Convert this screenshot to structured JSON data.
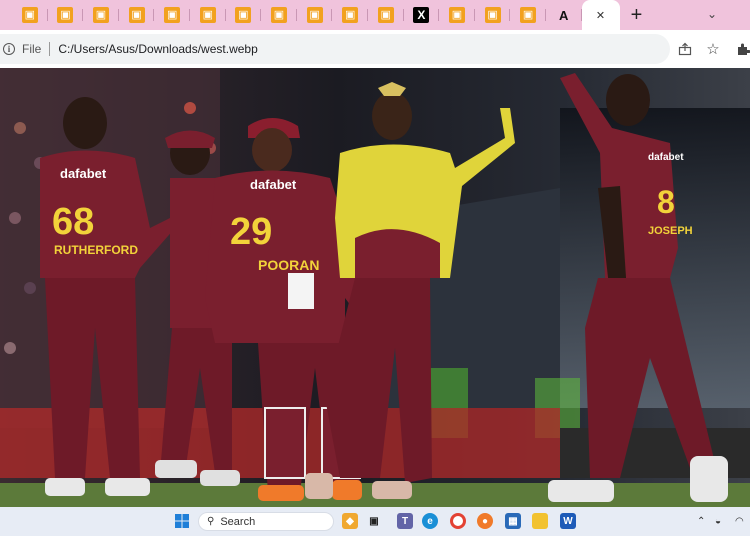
{
  "browser": {
    "tabs": [
      {
        "icon": "orange-favicon",
        "glyph": "▣"
      },
      {
        "icon": "orange-favicon",
        "glyph": "▣"
      },
      {
        "icon": "orange-favicon",
        "glyph": "▣"
      },
      {
        "icon": "orange-favicon",
        "glyph": "▣"
      },
      {
        "icon": "orange-favicon",
        "glyph": "▣"
      },
      {
        "icon": "orange-favicon",
        "glyph": "▣"
      },
      {
        "icon": "orange-favicon",
        "glyph": "▣"
      },
      {
        "icon": "orange-favicon",
        "glyph": "▣"
      },
      {
        "icon": "orange-favicon",
        "glyph": "▣"
      },
      {
        "icon": "orange-favicon",
        "glyph": "▣"
      },
      {
        "icon": "orange-favicon",
        "glyph": "▣"
      },
      {
        "icon": "x-favicon",
        "glyph": "X"
      },
      {
        "icon": "orange-favicon",
        "glyph": "▣"
      },
      {
        "icon": "orange-favicon",
        "glyph": "▣"
      },
      {
        "icon": "orange-favicon",
        "glyph": "▣"
      },
      {
        "icon": "a-favicon",
        "glyph": "A"
      }
    ],
    "active_tab_close": "✕",
    "new_tab": "+",
    "tab_search": "⌄",
    "address": {
      "scheme_label": "File",
      "url": "C:/Users/Asus/Downloads/west.webp"
    }
  },
  "photo": {
    "subject": "West Indies cricket players celebrating",
    "jerseys": [
      {
        "number": "68",
        "name": "RUTHERFORD",
        "sponsor": "dafabet"
      },
      {
        "number": "29",
        "name": "POORAN",
        "sponsor": "dafabet"
      },
      {
        "number": "8",
        "name": "JOSEPH",
        "sponsor": "dafabet"
      }
    ]
  },
  "taskbar": {
    "search_placeholder": "Search"
  },
  "colors": {
    "tab_strip": "#f0c3dc",
    "favicon_orange": "#f2a11f",
    "maroon_kit": "#7a1f2e",
    "yellow_kit": "#e8d93a",
    "taskbar": "#e7ecf5"
  }
}
